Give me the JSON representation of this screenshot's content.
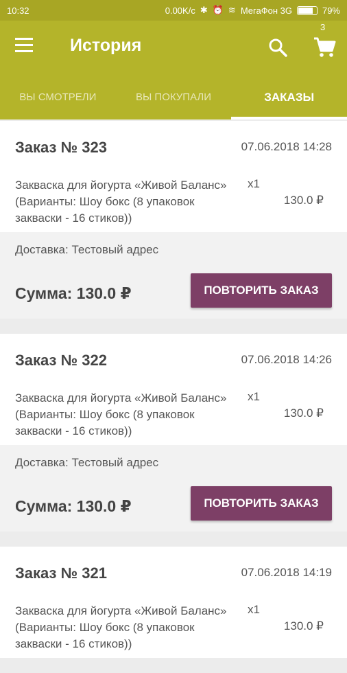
{
  "status": {
    "time": "10:32",
    "network_speed": "0.00K/c",
    "carrier": "МегаФон 3G",
    "battery": "79%"
  },
  "appbar": {
    "title": "История",
    "cart_count": "3"
  },
  "tabs": [
    {
      "label": "ВЫ СМОТРЕЛИ",
      "active": false
    },
    {
      "label": "ВЫ ПОКУПАЛИ",
      "active": false
    },
    {
      "label": "ЗАКАЗЫ",
      "active": true
    }
  ],
  "orders": [
    {
      "number": "Заказ № 323",
      "date": "07.06.2018 14:28",
      "item": "Закваска для йогурта «Живой Баланс» (Варианты: Шоу бокс (8 упаковок закваски - 16 стиков))",
      "qty": "x1",
      "price": "130.0 ₽",
      "delivery": "Доставка: Тестовый адрес",
      "sum": "Сумма: 130.0 ₽",
      "button": "ПОВТОРИТЬ ЗАКАЗ"
    },
    {
      "number": "Заказ № 322",
      "date": "07.06.2018 14:26",
      "item": "Закваска для йогурта «Живой Баланс» (Варианты: Шоу бокс (8 упаковок закваски - 16 стиков))",
      "qty": "x1",
      "price": "130.0 ₽",
      "delivery": "Доставка: Тестовый адрес",
      "sum": "Сумма: 130.0 ₽",
      "button": "ПОВТОРИТЬ ЗАКАЗ"
    },
    {
      "number": "Заказ № 321",
      "date": "07.06.2018 14:19",
      "item": "Закваска для йогурта «Живой Баланс» (Варианты: Шоу бокс (8 упаковок закваски - 16 стиков))",
      "qty": "x1",
      "price": "130.0 ₽",
      "delivery": "",
      "sum": "",
      "button": ""
    }
  ],
  "colors": {
    "appbar": "#b4b42a",
    "statusbar": "#a8a624",
    "button": "#7d3f66"
  },
  "icons": [
    "menu-icon",
    "search-icon",
    "cart-icon",
    "bluetooth-icon",
    "alarm-icon",
    "wifi-icon",
    "battery-icon"
  ]
}
